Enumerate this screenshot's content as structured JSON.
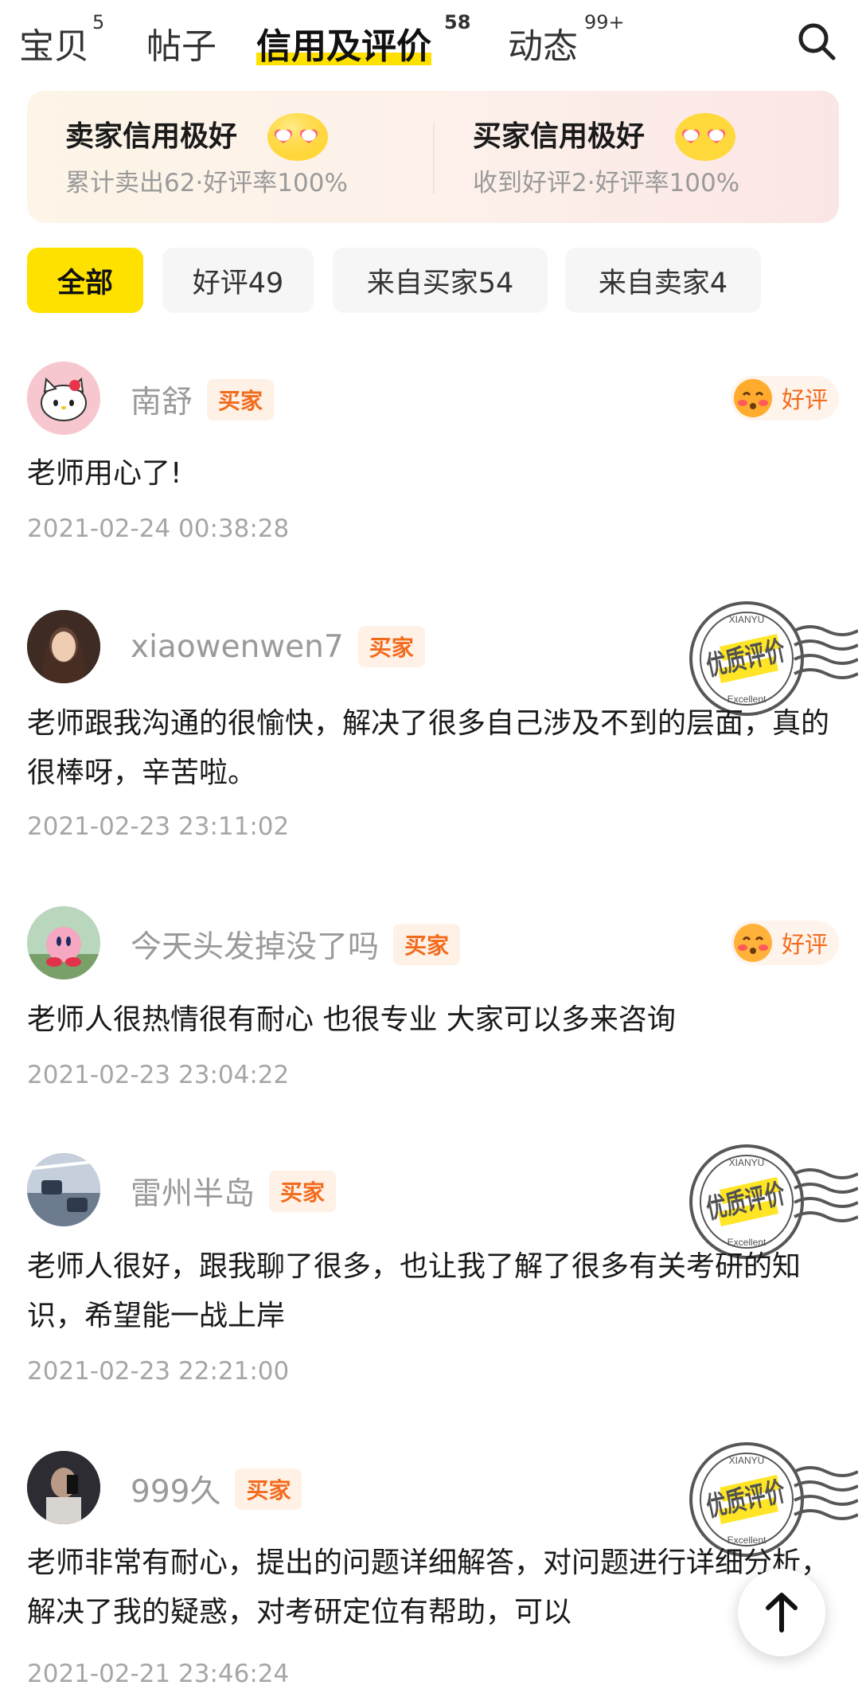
{
  "tabs": [
    {
      "label": "宝贝",
      "count": "5"
    },
    {
      "label": "帖子",
      "count": ""
    },
    {
      "label": "信用及评价",
      "count": "58"
    },
    {
      "label": "动态",
      "count": "99+"
    }
  ],
  "credit": {
    "seller": {
      "title": "卖家信用极好",
      "detail": "累计卖出62·好评率100%"
    },
    "buyer": {
      "title": "买家信用极好",
      "detail": "收到好评2·好评率100%"
    }
  },
  "filters": [
    "全部",
    "好评49",
    "来自买家54",
    "来自卖家4"
  ],
  "reviews": [
    {
      "name": "南舒",
      "role": "买家",
      "rating": "好评",
      "text": "老师用心了!",
      "time": "2021-02-24 00:38:28"
    },
    {
      "name": "xiaowenwen7",
      "role": "买家",
      "stamp": {
        "top": "XIANYU",
        "main": "优质评价",
        "bottom": "Excellent"
      },
      "text": "老师跟我沟通的很愉快，解决了很多自己涉及不到的层面，真的很棒呀，辛苦啦。",
      "time": "2021-02-23 23:11:02"
    },
    {
      "name": "今天头发掉没了吗",
      "role": "买家",
      "rating": "好评",
      "text": "老师人很热情很有耐心 也很专业 大家可以多来咨询",
      "time": "2021-02-23 23:04:22"
    },
    {
      "name": "雷州半岛",
      "role": "买家",
      "stamp": {
        "top": "XIANYU",
        "main": "优质评价",
        "bottom": "Excellent"
      },
      "text": "老师人很好，跟我聊了很多，也让我了解了很多有关考研的知识，希望能一战上岸",
      "time": "2021-02-23 22:21:00"
    },
    {
      "name": "999久",
      "role": "买家",
      "stamp": {
        "top": "XIANYU",
        "main": "优质评价",
        "bottom": "Excellent"
      },
      "text": "老师非常有耐心，提出的问题详细解答，对问题进行详细分析，解决了我的疑惑，对考研定位有帮助，可以",
      "time": "2021-02-21 23:46:24"
    }
  ],
  "colors": {
    "accent": "#ffe100",
    "badge": "#f26b1d",
    "muted": "#9a9a9a"
  }
}
